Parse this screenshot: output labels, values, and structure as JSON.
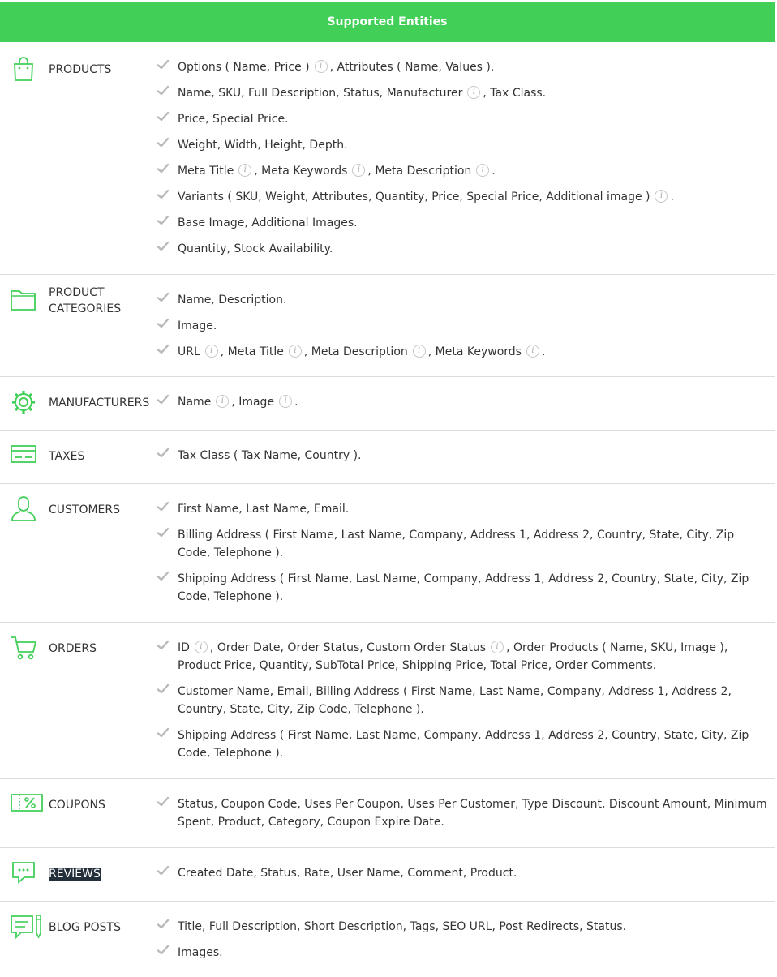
{
  "header": {
    "title": "Supported Entities"
  },
  "colors": {
    "accent": "#41cf57",
    "icon": "#41cf57"
  },
  "sections": [
    {
      "id": "products",
      "icon": "shopping-bag-icon",
      "title": "PRODUCTS",
      "items": [
        [
          "Options ( Name, Price )",
          "i",
          ", Attributes ( Name, Values )."
        ],
        [
          "Name, SKU, Full Description, Status, Manufacturer",
          "i",
          ", Tax Class."
        ],
        [
          "Price, Special Price."
        ],
        [
          "Weight, Width, Height, Depth."
        ],
        [
          "Meta Title",
          "i",
          ", Meta Keywords",
          "i",
          ", Meta Description",
          "i",
          "."
        ],
        [
          "Variants ( SKU, Weight, Attributes, Quantity, Price, Special Price, Additional image )",
          "i",
          "."
        ],
        [
          "Base Image, Additional Images."
        ],
        [
          "Quantity, Stock Availability."
        ]
      ]
    },
    {
      "id": "product-categories",
      "icon": "folder-icon",
      "title": "PRODUCT CATEGORIES",
      "items": [
        [
          "Name, Description."
        ],
        [
          "Image."
        ],
        [
          "URL",
          "i",
          ", Meta Title",
          "i",
          ", Meta Description",
          "i",
          ", Meta Keywords",
          "i",
          "."
        ]
      ]
    },
    {
      "id": "manufacturers",
      "icon": "gear-icon",
      "title": "MANUFACTURERS",
      "items": [
        [
          "Name",
          "i",
          ", Image",
          "i",
          "."
        ]
      ]
    },
    {
      "id": "taxes",
      "icon": "credit-card-icon",
      "title": "TAXES",
      "items": [
        [
          "Tax Class ( Tax Name, Country )."
        ]
      ]
    },
    {
      "id": "customers",
      "icon": "user-icon",
      "title": "CUSTOMERS",
      "items": [
        [
          "First Name, Last Name, Email."
        ],
        [
          "Billing Address ( First Name, Last Name, Company, Address 1, Address 2, Country, State, City, Zip Code, Telephone )."
        ],
        [
          "Shipping Address ( First Name, Last Name, Company, Address 1, Address 2, Country, State, City, Zip Code, Telephone )."
        ]
      ]
    },
    {
      "id": "orders",
      "icon": "shopping-cart-icon",
      "title": "ORDERS",
      "items": [
        [
          "ID",
          "i",
          ", Order Date, Order Status, Custom Order Status",
          "i",
          ", Order Products ( Name, SKU, Image ), Product Price, Quantity, SubTotal Price, Shipping Price, Total Price, Order Comments."
        ],
        [
          "Customer Name, Email, Billing Address ( First Name, Last Name, Company, Address 1, Address 2, Country, State, City, Zip Code, Telephone )."
        ],
        [
          "Shipping Address ( First Name, Last Name, Company, Address 1, Address 2, Country, State, City, Zip Code, Telephone )."
        ]
      ]
    },
    {
      "id": "coupons",
      "icon": "coupon-icon",
      "title": "COUPONS",
      "items": [
        [
          "Status, Coupon Code, Uses Per Coupon, Uses Per Customer, Type Discount, Discount Amount, Minimum Spent, Product, Category, Coupon Expire Date."
        ]
      ]
    },
    {
      "id": "reviews",
      "icon": "chat-bubble-icon",
      "title": "REVIEWS",
      "highlighted": true,
      "items": [
        [
          "Created Date, Status, Rate, User Name, Comment, Product."
        ]
      ]
    },
    {
      "id": "blog-posts",
      "icon": "blog-edit-icon",
      "title": "BLOG POSTS",
      "items": [
        [
          "Title, Full Description, Short Description, Tags, SEO URL, Post Redirects, Status."
        ],
        [
          "Images."
        ]
      ]
    }
  ]
}
